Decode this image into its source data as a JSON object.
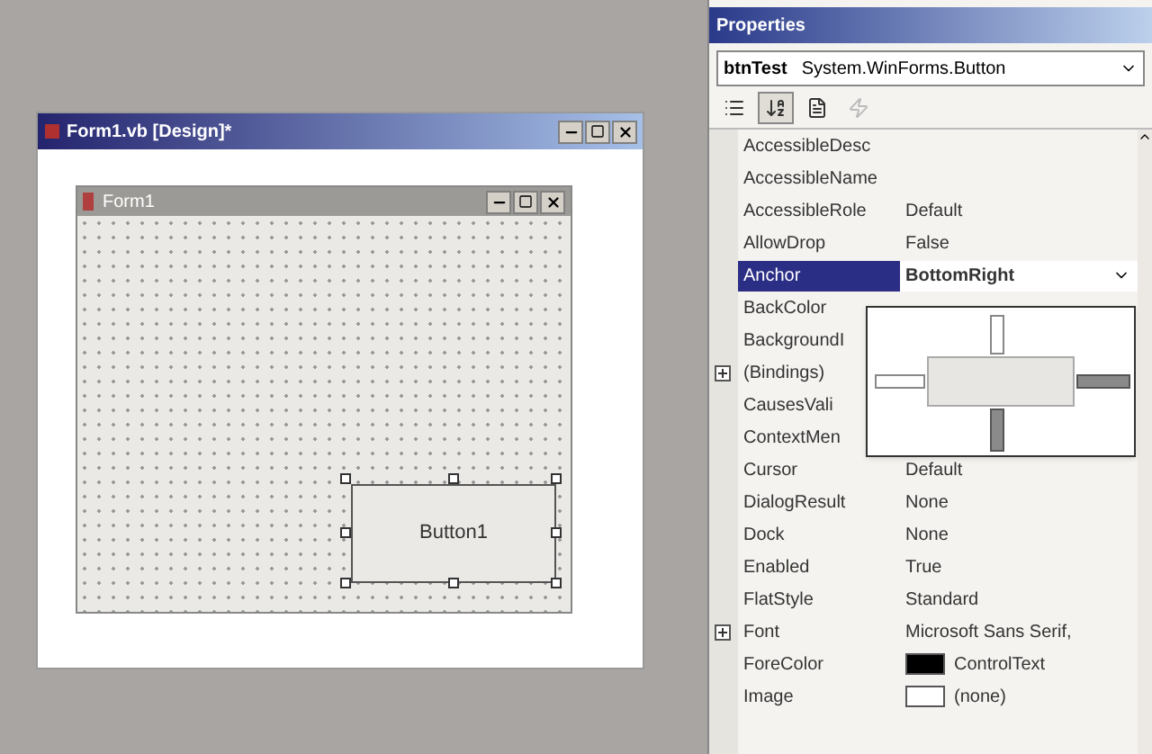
{
  "designer": {
    "title": "Form1.vb [Design]*",
    "form": {
      "title": "Form1",
      "button": {
        "label": "Button1",
        "selected": true
      }
    }
  },
  "properties": {
    "title": "Properties",
    "object": {
      "name": "btnTest",
      "type": "System.WinForms.Button"
    },
    "toolbar": [
      {
        "kind": "categorized",
        "selected": false,
        "disabled": false
      },
      {
        "kind": "alphabetic",
        "selected": true,
        "disabled": false
      },
      {
        "kind": "pages",
        "selected": false,
        "disabled": false
      },
      {
        "kind": "events",
        "selected": false,
        "disabled": true
      }
    ],
    "rows": [
      {
        "name": "AccessibleDesc"
      },
      {
        "name": "AccessibleName"
      },
      {
        "name": "AccessibleRole",
        "value": "Default"
      },
      {
        "name": "AllowDrop",
        "value": "False"
      },
      {
        "name": "Anchor",
        "value": "BottomRight",
        "selected": true
      },
      {
        "name": "BackColor"
      },
      {
        "name": "BackgroundI"
      },
      {
        "name": "(Bindings)",
        "expanded": false
      },
      {
        "name": "CausesVali"
      },
      {
        "name": "ContextMen"
      },
      {
        "name": "Cursor",
        "value": "Default"
      },
      {
        "name": "DialogResult",
        "value": "None"
      },
      {
        "name": "Dock",
        "value": "None"
      },
      {
        "name": "Enabled",
        "value": "True"
      },
      {
        "name": "FlatStyle",
        "value": "Standard"
      },
      {
        "name": "Font",
        "value": "Microsoft Sans Serif,",
        "expanded": false
      },
      {
        "name": "ForeColor",
        "value": "ControlText",
        "color": "#000000"
      },
      {
        "name": "Image",
        "value": "(none)",
        "color": "#ffffff"
      }
    ],
    "anchor_editor": {
      "top": false,
      "left": false,
      "right": true,
      "bottom": true
    }
  }
}
